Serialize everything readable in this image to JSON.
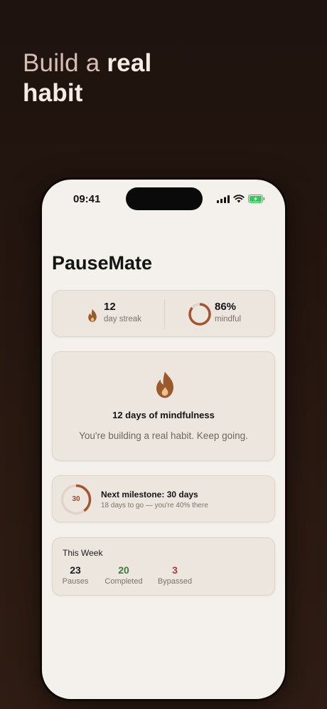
{
  "headline": {
    "light": "Build a",
    "bold_1": "real",
    "bold_2": "habit"
  },
  "status_bar": {
    "time": "09:41"
  },
  "app": {
    "title": "PauseMate"
  },
  "stats": {
    "streak_value": "12",
    "streak_label": "day streak",
    "mindful_value": "86%",
    "mindful_label": "mindful",
    "mindful_fraction": 0.86
  },
  "hero": {
    "title": "12 days of mindfulness",
    "subtitle": "You're building a real habit. Keep going."
  },
  "milestone": {
    "ring_value": "30",
    "title": "Next milestone: 30 days",
    "subtitle": "18 days to go — you're 40% there",
    "progress_fraction": 0.4
  },
  "week": {
    "title": "This Week",
    "pauses_value": "23",
    "pauses_label": "Pauses",
    "completed_value": "20",
    "completed_label": "Completed",
    "bypassed_value": "3",
    "bypassed_label": "Bypassed"
  },
  "colors": {
    "accent_brown": "#9a5a2e",
    "ring_rust": "#a6542e",
    "completed_green": "#3f7a3a",
    "bypassed_red": "#b23a34"
  }
}
